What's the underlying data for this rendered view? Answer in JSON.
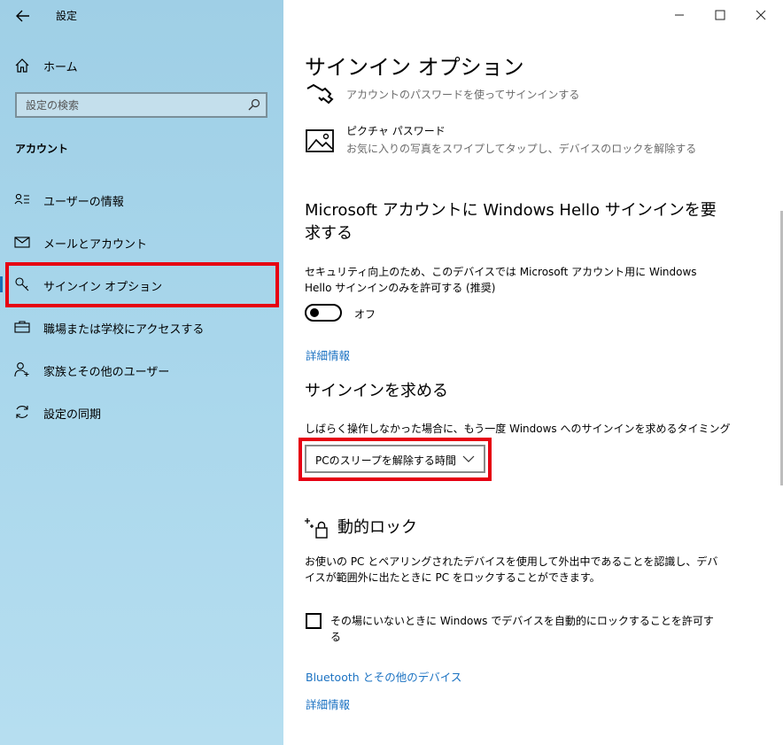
{
  "window": {
    "title": "設定",
    "minimize_icon": "minimize-icon",
    "maximize_icon": "maximize-icon",
    "close_icon": "close-icon"
  },
  "sidebar": {
    "home_label": "ホーム",
    "search_placeholder": "設定の検索",
    "section_title": "アカウント",
    "items": [
      {
        "label": "ユーザーの情報",
        "icon": "user-info-icon"
      },
      {
        "label": "メールとアカウント",
        "icon": "mail-icon"
      },
      {
        "label": "サインイン オプション",
        "icon": "key-icon",
        "selected": true
      },
      {
        "label": "職場または学校にアクセスする",
        "icon": "briefcase-icon"
      },
      {
        "label": "家族とその他のユーザー",
        "icon": "person-add-icon"
      },
      {
        "label": "設定の同期",
        "icon": "sync-icon"
      }
    ]
  },
  "main": {
    "title": "サインイン オプション",
    "password_option": {
      "subtitle": "アカウントのパスワードを使ってサインインする"
    },
    "picture_password": {
      "title": "ピクチャ パスワード",
      "subtitle": "お気に入りの写真をスワイプしてタップし、デバイスのロックを解除する"
    },
    "hello_section": {
      "heading_line1": "Microsoft アカウントに Windows Hello サインインを要",
      "heading_line2": "求する",
      "desc_line1": "セキュリティ向上のため、このデバイスでは Microsoft アカウント用に Windows",
      "desc_line2": "Hello サインインのみを許可する (推奨)",
      "toggle_state": "オフ",
      "link": "詳細情報"
    },
    "require_signin": {
      "heading": "サインインを求める",
      "desc": "しばらく操作しなかった場合に、もう一度 Windows へのサインインを求めるタイミング",
      "dropdown_value": "PCのスリープを解除する時間"
    },
    "dynamic_lock": {
      "heading": "動的ロック",
      "desc_line1": "お使いの PC とペアリングされたデバイスを使用して外出中であることを認識し、デバ",
      "desc_line2": "イスが範囲外に出たときに PC をロックすることができます。",
      "checkbox_line1": "その場にいないときに Windows でデバイスを自動的にロックすることを許可す",
      "checkbox_line2": "る",
      "checked": false,
      "link_bluetooth": "Bluetooth とその他のデバイス",
      "link_more": "詳細情報"
    }
  },
  "colors": {
    "sidebar_bg": "#a8d6eb",
    "link": "#1b72c2",
    "highlight_box": "#e60012",
    "selected_indicator": "#1a6fb5"
  }
}
